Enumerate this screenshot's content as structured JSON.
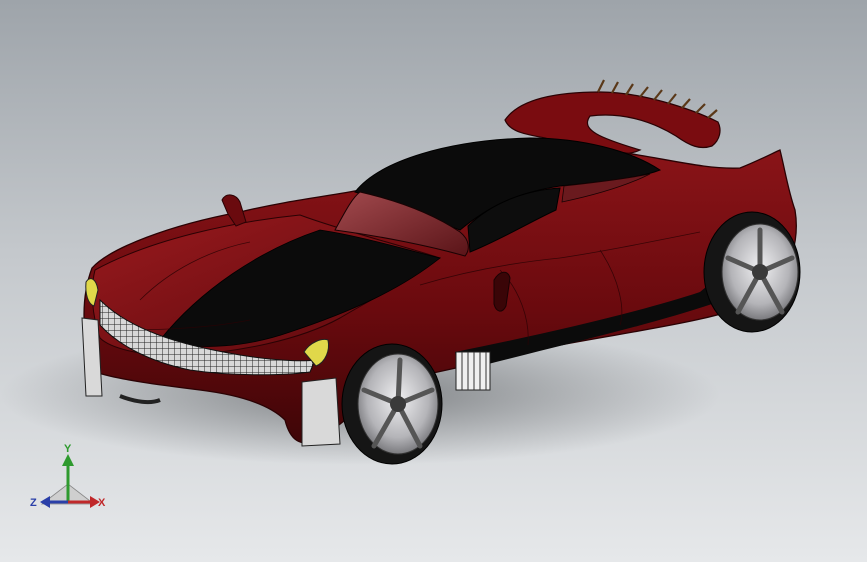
{
  "viewport": {
    "background_top": "#9ea4aa",
    "background_bottom": "#e6e8ea"
  },
  "model": {
    "body_color": "#6e0a0e",
    "stripe_color": "#0b0b0b",
    "glass_color": "#8a3438",
    "wheel_color": "#b9b9bd"
  },
  "triad": {
    "x_label": "X",
    "y_label": "Y",
    "z_label": "Z",
    "x_color": "#c0282a",
    "y_color": "#2e9a2e",
    "z_color": "#2a3fa8"
  }
}
